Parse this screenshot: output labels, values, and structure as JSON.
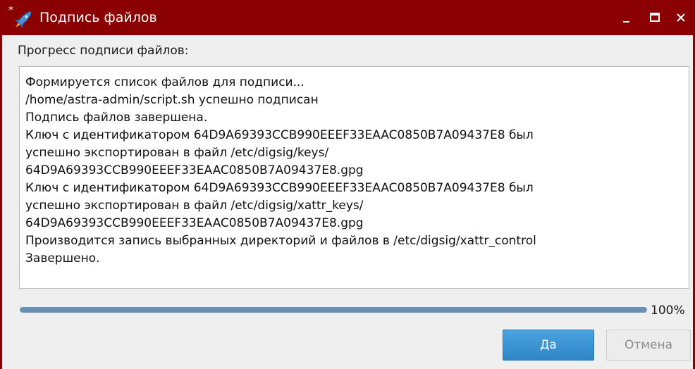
{
  "window": {
    "title": "Подпись файлов",
    "colors": {
      "titlebar": "#8b0000",
      "accent": "#2f86c8"
    }
  },
  "icons": {
    "app": "rocket-icon",
    "minimize": "minimize-icon",
    "maximize": "maximize-icon",
    "close": "close-icon"
  },
  "progress": {
    "label": "Прогресс подписи файлов:",
    "percent_text": "100%",
    "fraction": 1.0
  },
  "log": {
    "lines": [
      "Формируется список файлов для подписи...",
      "/home/astra-admin/script.sh успешно подписан",
      "Подпись файлов завершена.",
      "Ключ с идентификатором 64D9A69393CCB990EEEF33EAAC0850B7A09437E8 был",
      "успешно экспортирован в файл /etc/digsig/keys/",
      "64D9A69393CCB990EEEF33EAAC0850B7A09437E8.gpg",
      "Ключ с идентификатором 64D9A69393CCB990EEEF33EAAC0850B7A09437E8 был",
      "успешно экспортирован в файл /etc/digsig/xattr_keys/",
      "64D9A69393CCB990EEEF33EAAC0850B7A09437E8.gpg",
      "Производится запись выбранных директорий и файлов в /etc/digsig/xattr_control",
      "Завершено."
    ]
  },
  "buttons": {
    "ok_label": "Да",
    "cancel_label": "Отмена"
  }
}
